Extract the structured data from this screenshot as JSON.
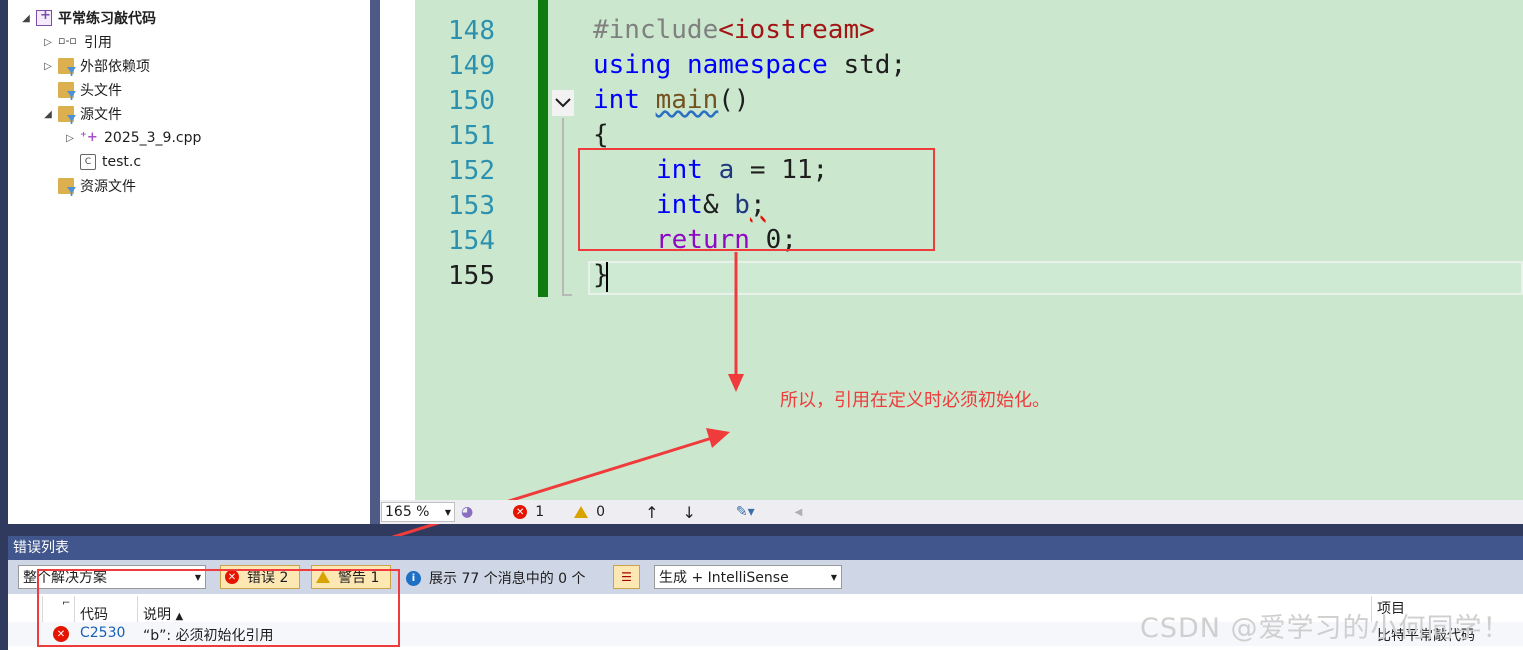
{
  "explorer": {
    "project": "平常练习敲代码",
    "items": [
      {
        "label": "引用"
      },
      {
        "label": "外部依赖项"
      },
      {
        "label": "头文件"
      },
      {
        "label": "源文件"
      },
      {
        "label": "2025_3_9.cpp"
      },
      {
        "label": "test.c"
      },
      {
        "label": "资源文件"
      }
    ]
  },
  "editor": {
    "line_numbers": [
      "148",
      "149",
      "150",
      "151",
      "152",
      "153",
      "154",
      "155"
    ],
    "code": {
      "l148_pp": "#include",
      "l148_str": "<iostream>",
      "l149_kw1": "using",
      "l149_kw2": "namespace",
      "l149_rest": " std;",
      "l150_kw": "int",
      "l150_fn": "main",
      "l150_rest": "()",
      "l151": "{",
      "l152_kw": "int",
      "l152_var": "a",
      "l152_rest": " = 11;",
      "l153_kw": "int",
      "l153_mid": "& ",
      "l153_var": "b",
      "l153_rest": ";",
      "l154_ctrl": "return",
      "l154_rest": " 0;",
      "l155": "}"
    },
    "annotation": "所以，引用在定义时必须初始化。"
  },
  "status": {
    "zoom": "165 %",
    "errors": "1",
    "warnings": "0"
  },
  "error_list": {
    "title": "错误列表",
    "scope": "整个解决方案",
    "errors_btn": "错误 2",
    "warnings_btn": "警告 1",
    "messages": "展示 77 个消息中的 0 个",
    "build_filter": "生成 + IntelliSense",
    "col_code": "代码",
    "col_desc": "说明",
    "col_project": "项目",
    "rows": [
      {
        "code": "C2530",
        "desc": "“b”: 必须初始化引用",
        "project": "比特平常敲代码"
      }
    ]
  },
  "watermark": "CSDN @爱学习的小何同学！",
  "colors": {
    "accent": "#40568d",
    "annotation": "#ef3b3b",
    "error": "#e51400"
  }
}
